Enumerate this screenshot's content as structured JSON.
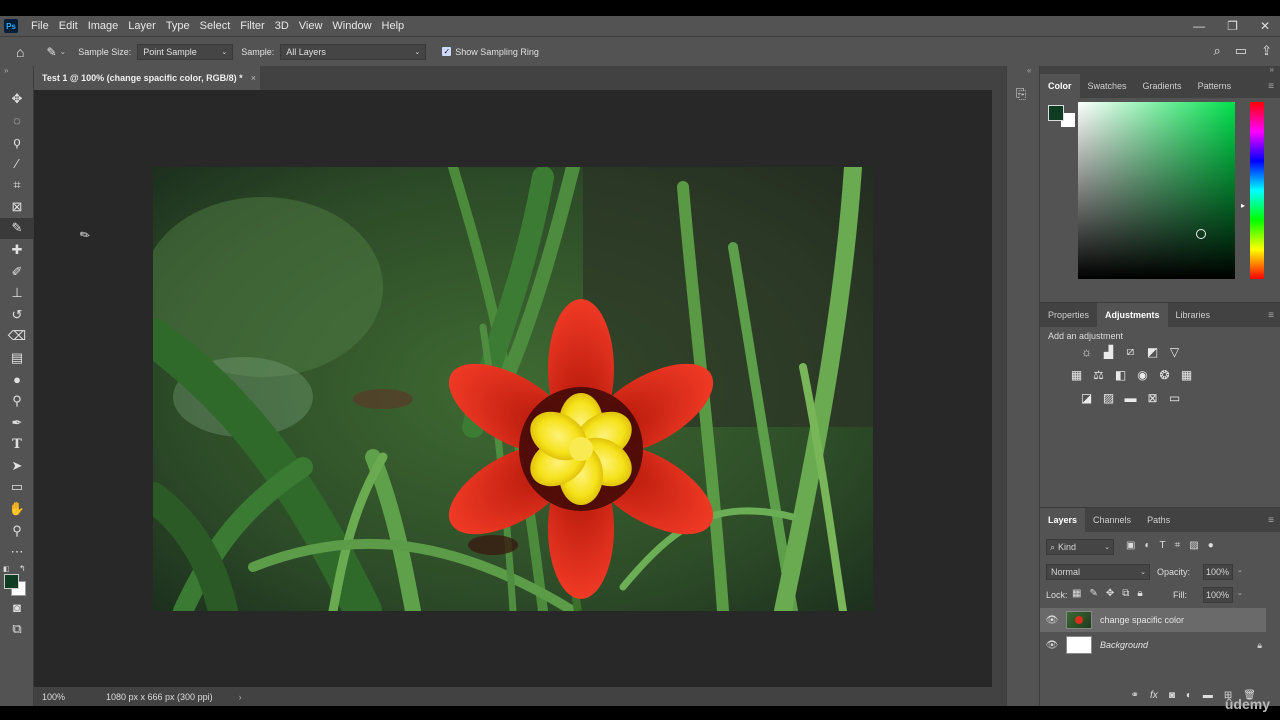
{
  "app": {
    "logo_text": "Ps"
  },
  "menu": [
    "File",
    "Edit",
    "Image",
    "Layer",
    "Type",
    "Select",
    "Filter",
    "3D",
    "View",
    "Window",
    "Help"
  ],
  "window_controls": {
    "minimize": "—",
    "restore": "❐",
    "close": "✕"
  },
  "options_bar": {
    "sample_size_label": "Sample Size:",
    "sample_size_value": "Point Sample",
    "sample_label": "Sample:",
    "sample_value": "All Layers",
    "show_sampling_ring_label": "Show Sampling Ring",
    "show_sampling_ring_checked": true
  },
  "document": {
    "tab_title": "Test 1 @ 100% (change spacific color, RGB/8) *",
    "close_glyph": "×",
    "zoom": "100%",
    "doc_info": "1080 px x 666 px (300 ppi)"
  },
  "color_panel": {
    "tabs": [
      "Color",
      "Swatches",
      "Gradients",
      "Patterns"
    ],
    "active_tab": "Color",
    "foreground": "#0e3d23",
    "background": "#ffffff",
    "hue_color": "#00e04c"
  },
  "adjustments_panel": {
    "tabs": [
      "Properties",
      "Adjustments",
      "Libraries"
    ],
    "active_tab": "Adjustments",
    "add_adjustment_label": "Add an adjustment",
    "rows": [
      [
        "brightness-contrast-icon",
        "levels-icon",
        "curves-icon",
        "exposure-icon",
        "vibrance-icon"
      ],
      [
        "hue-saturation-icon",
        "color-balance-icon",
        "black-white-icon",
        "photo-filter-icon",
        "channel-mixer-icon",
        "color-lookup-icon"
      ],
      [
        "invert-icon",
        "posterize-icon",
        "threshold-icon",
        "selective-color-icon",
        "gradient-map-icon"
      ]
    ]
  },
  "layers_panel": {
    "tabs": [
      "Layers",
      "Channels",
      "Paths"
    ],
    "active_tab": "Layers",
    "filter_kind": "Kind",
    "blend_mode": "Normal",
    "opacity_label": "Opacity:",
    "opacity_value": "100%",
    "lock_label": "Lock:",
    "fill_label": "Fill:",
    "fill_value": "100%",
    "layers": [
      {
        "name": "change spacific color",
        "visible": true,
        "selected": true,
        "locked": false
      },
      {
        "name": "Background",
        "visible": true,
        "selected": false,
        "locked": true
      }
    ]
  },
  "watermark": "ûdemy"
}
